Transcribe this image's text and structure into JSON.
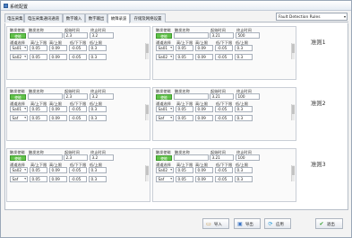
{
  "window": {
    "title": "系统配置"
  },
  "tabs": [
    {
      "label": "电压采集"
    },
    {
      "label": "电压采集通讯通道"
    },
    {
      "label": "数字输入"
    },
    {
      "label": "数字输出"
    },
    {
      "label": "故障录波"
    },
    {
      "label": "存储及网络设置"
    }
  ],
  "rule_select": {
    "value": "Fault Detection Rules"
  },
  "panel_labels": {
    "trigger_enable": "触发使能",
    "trigger_name": "触发名称",
    "start_time": "起始时间",
    "end_time": "终止时间",
    "channel_select": "通道选择",
    "high_lower": "高/上下限",
    "high_upper": "高/上限",
    "low_lower": "低/下下限",
    "low_upper": "低/上限",
    "enable_btn": "使能"
  },
  "rules": [
    {
      "label": "准则1",
      "panels": [
        {
          "start": "2.3",
          "end": "3.2",
          "rows": [
            [
              "Sa01",
              "0.05",
              "0.09",
              "-0.05",
              "0.3"
            ],
            [
              "Sa02",
              "0.05",
              "0.09",
              "-0.05",
              "0.3"
            ]
          ]
        },
        {
          "start": "3.21",
          "end": "500",
          "rows": [
            [
              "Sa01",
              "0.05",
              "0.09",
              "-0.05",
              "0.3"
            ],
            [
              "Sa02",
              "0.05",
              "0.09",
              "-0.05",
              "0.3"
            ]
          ]
        }
      ]
    },
    {
      "label": "准则2",
      "panels": [
        {
          "start": "2.3",
          "end": "3.2",
          "rows": [
            [
              "Sa01",
              "0.05",
              "0.09",
              "-0.05",
              "0.3"
            ],
            [
              "Saf",
              "0.05",
              "0.09",
              "-0.05",
              "0.3"
            ]
          ]
        },
        {
          "start": "3.21",
          "end": "100",
          "rows": [
            [
              "Sa01",
              "0.05",
              "0.09",
              "-0.05",
              "0.3"
            ],
            [
              "Saf",
              "0.05",
              "0.09",
              "-0.05",
              "0.3"
            ]
          ]
        }
      ]
    },
    {
      "label": "准则3",
      "panels": [
        {
          "start": "2.3",
          "end": "3.2",
          "rows": [
            [
              "Sa02",
              "0.05",
              "0.09",
              "-0.05",
              "0.3"
            ],
            [
              "Saf",
              "0.05",
              "0.09",
              "-0.05",
              "0.3"
            ]
          ]
        },
        {
          "start": "3.21",
          "end": "100",
          "rows": [
            [
              "Sa02",
              "0.05",
              "0.09",
              "-0.05",
              "0.3"
            ],
            [
              "Saf",
              "0.05",
              "0.09",
              "-0.05",
              "0.3"
            ]
          ]
        }
      ]
    }
  ],
  "bottom_buttons": {
    "import": "导入",
    "export": "导出",
    "apply": "应用",
    "exit": "退出"
  }
}
